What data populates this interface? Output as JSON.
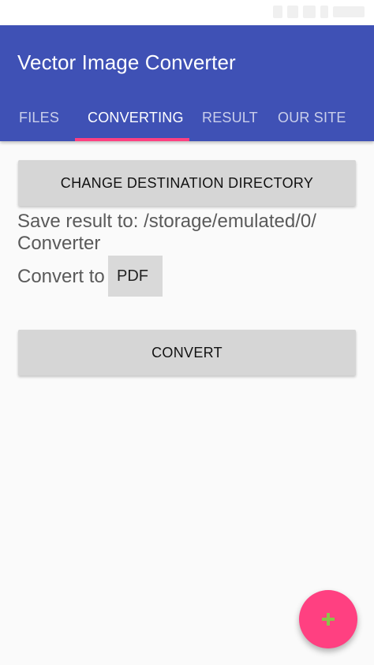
{
  "app": {
    "title": "Vector Image Converter"
  },
  "tabs": [
    {
      "label": "FILES"
    },
    {
      "label": "CONVERTING"
    },
    {
      "label": "RESULT"
    },
    {
      "label": "OUR SITE"
    }
  ],
  "main": {
    "change_dir_label": "CHANGE DESTINATION DIRECTORY",
    "save_result_line1": "Save result to: /storage/emulated/0/",
    "save_result_line2": "Converter",
    "convert_to_label": "Convert to",
    "format_value": "PDF",
    "convert_label": "CONVERT"
  },
  "fab": {
    "icon": "plus-icon"
  },
  "colors": {
    "primary": "#3f51b5",
    "accent": "#ff4081",
    "fab_plus": "#8bc34a"
  }
}
